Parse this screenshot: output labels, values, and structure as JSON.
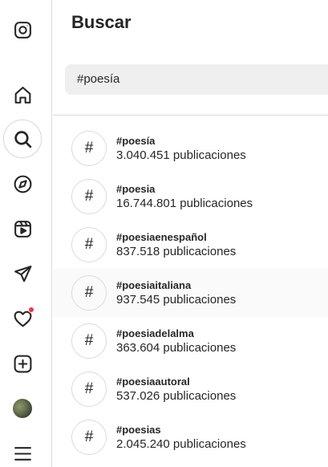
{
  "sidebar": {
    "items": [
      {
        "name": "instagram-logo",
        "icon": "instagram-icon"
      },
      {
        "name": "home",
        "icon": "home-icon"
      },
      {
        "name": "search",
        "icon": "search-icon",
        "active": true
      },
      {
        "name": "explore",
        "icon": "compass-icon"
      },
      {
        "name": "reels",
        "icon": "reels-icon"
      },
      {
        "name": "messages",
        "icon": "send-icon"
      },
      {
        "name": "notifications",
        "icon": "heart-icon",
        "has_notification": true
      },
      {
        "name": "create",
        "icon": "plus-square-icon"
      },
      {
        "name": "profile",
        "icon": "avatar"
      },
      {
        "name": "more",
        "icon": "menu-icon"
      }
    ],
    "notification_color": "#ff3040"
  },
  "panel": {
    "title": "Buscar",
    "search_value": "#poesía"
  },
  "results": [
    {
      "tag": "#poesía",
      "count": "3.040.451 publicaciones"
    },
    {
      "tag": "#poesia",
      "count": "16.744.801 publicaciones"
    },
    {
      "tag": "#poesiaenespañol",
      "count": "837.518 publicaciones"
    },
    {
      "tag": "#poesiaitaliana",
      "count": "937.545 publicaciones"
    },
    {
      "tag": "#poesiadelalma",
      "count": "363.604 publicaciones"
    },
    {
      "tag": "#poesiaautoral",
      "count": "537.026 publicaciones"
    },
    {
      "tag": "#poesias",
      "count": "2.045.240 publicaciones"
    }
  ],
  "hash_symbol": "#"
}
